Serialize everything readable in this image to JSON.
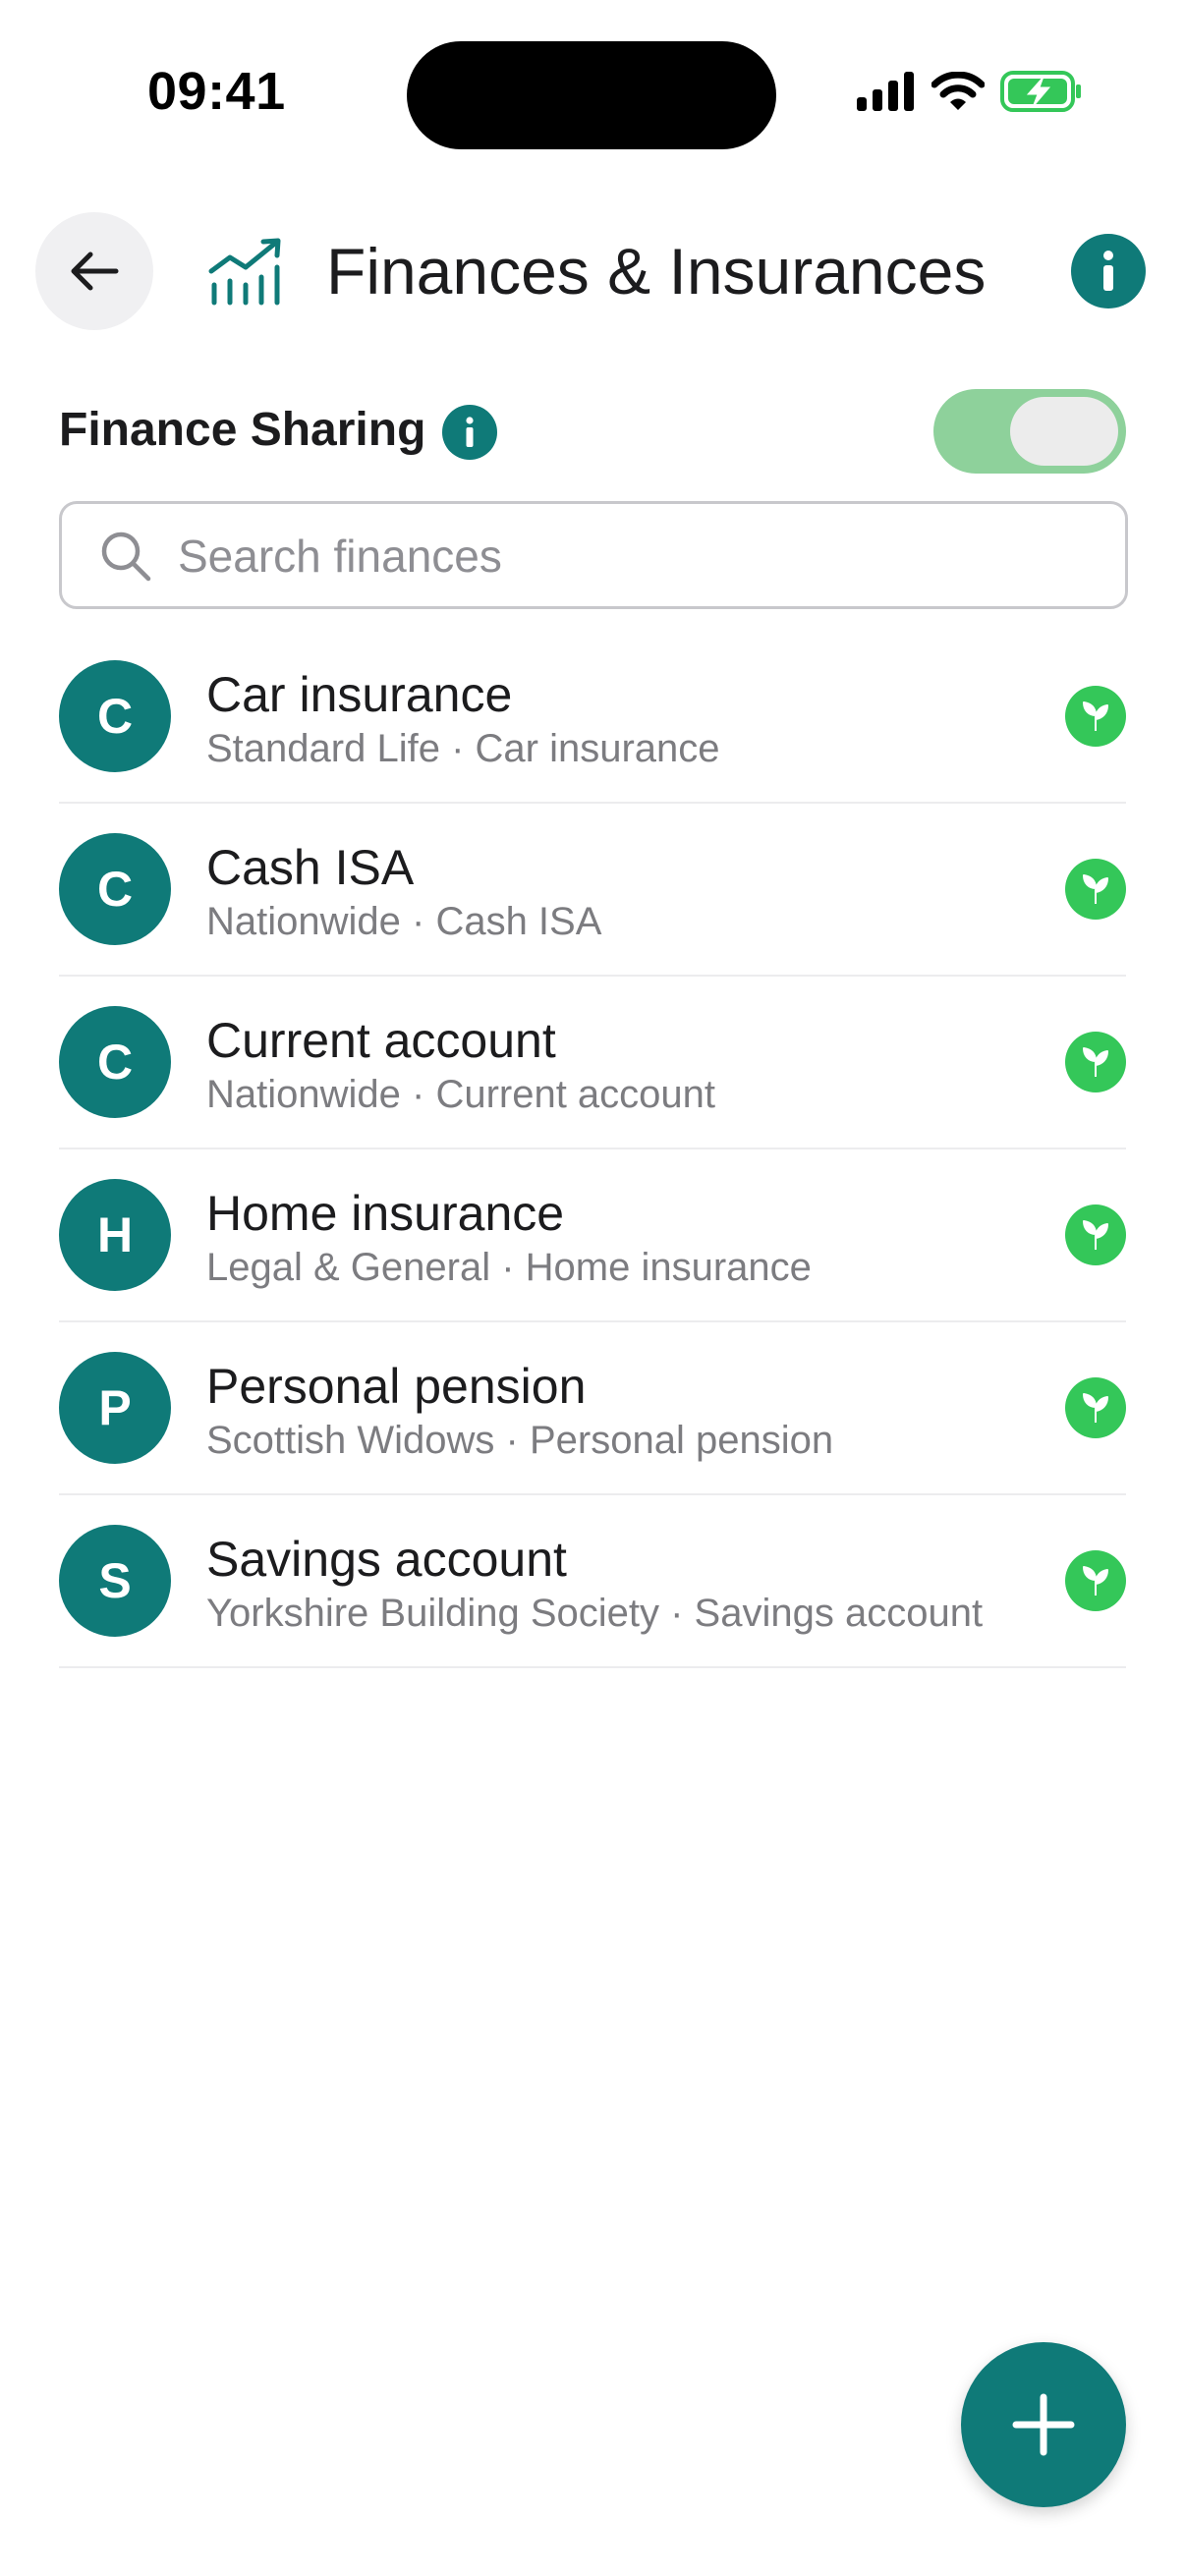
{
  "status_bar": {
    "time": "09:41",
    "icons": [
      "cellular-signal-icon",
      "wifi-icon",
      "battery-charging-icon"
    ]
  },
  "header": {
    "back_icon": "arrow-left-icon",
    "category_icon": "chart-growth-icon",
    "title": "Finances & Insurances",
    "info_icon": "info-icon"
  },
  "sharing": {
    "label": "Finance Sharing",
    "info_icon": "info-icon",
    "enabled": true
  },
  "search": {
    "placeholder": "Search finances",
    "value": ""
  },
  "items": [
    {
      "initial": "C",
      "title": "Car insurance",
      "subtitle": "Standard Life · Car insurance",
      "status_icon": "shared-leaf-icon"
    },
    {
      "initial": "C",
      "title": "Cash ISA",
      "subtitle": "Nationwide · Cash ISA",
      "status_icon": "shared-leaf-icon"
    },
    {
      "initial": "C",
      "title": "Current account",
      "subtitle": "Nationwide · Current account",
      "status_icon": "shared-leaf-icon"
    },
    {
      "initial": "H",
      "title": "Home insurance",
      "subtitle": "Legal & General · Home insurance",
      "status_icon": "shared-leaf-icon"
    },
    {
      "initial": "P",
      "title": "Personal pension",
      "subtitle": "Scottish Widows · Personal pension",
      "status_icon": "shared-leaf-icon"
    },
    {
      "initial": "S",
      "title": "Savings account",
      "subtitle": "Yorkshire Building Society · Savings account",
      "status_icon": "shared-leaf-icon"
    }
  ],
  "fab": {
    "icon": "plus-icon"
  },
  "colors": {
    "accent": "#0f7a78",
    "status_green": "#34c759",
    "toggle_on": "#8ed19b"
  }
}
